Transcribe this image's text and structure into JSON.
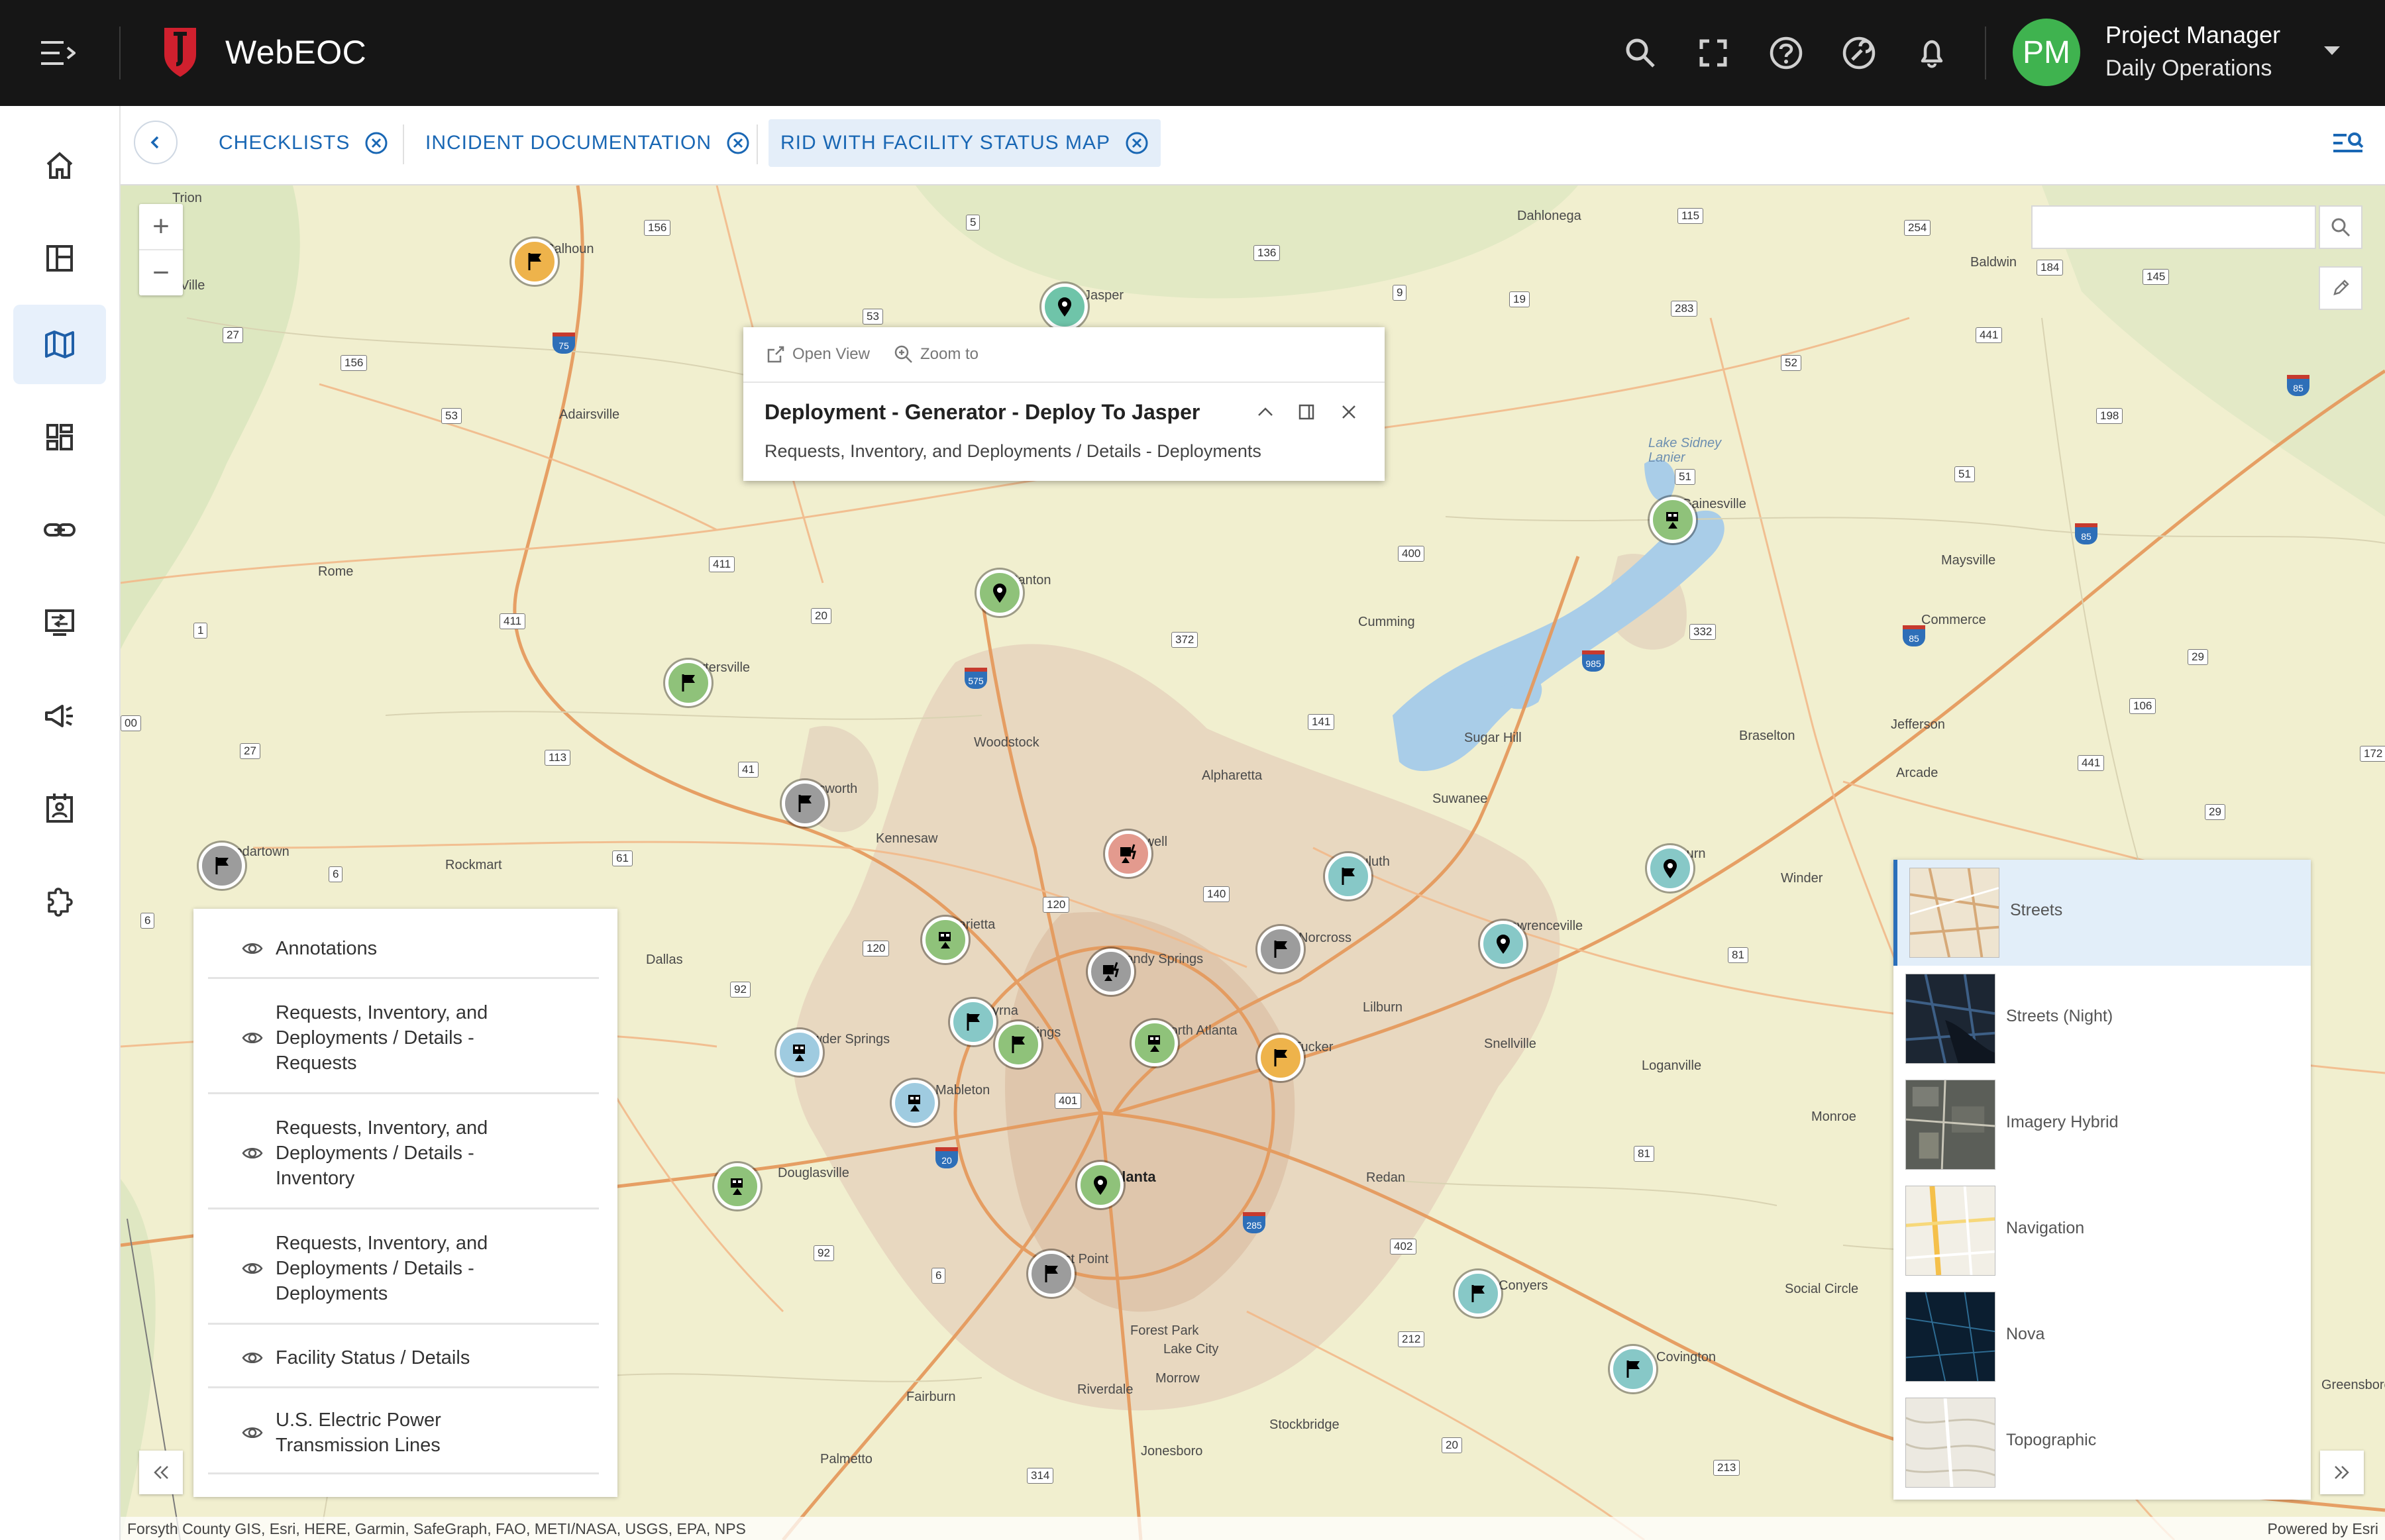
{
  "header": {
    "app_title": "WebEOC",
    "user_initials": "PM",
    "user_name": "Project Manager",
    "user_role": "Daily Operations",
    "colors": {
      "bar": "#161616",
      "logo": "#d0202e",
      "avatar": "#3fb34f"
    }
  },
  "nav": {
    "items": [
      {
        "name": "home",
        "icon": "home-icon"
      },
      {
        "name": "boards",
        "icon": "layout-icon"
      },
      {
        "name": "maps",
        "icon": "map-icon",
        "active": true
      },
      {
        "name": "dashboards",
        "icon": "dashboard-icon"
      },
      {
        "name": "links",
        "icon": "link-icon"
      },
      {
        "name": "processes",
        "icon": "monitor-icon"
      },
      {
        "name": "alerts",
        "icon": "megaphone-icon"
      },
      {
        "name": "contacts",
        "icon": "contact-card-icon"
      },
      {
        "name": "plugins",
        "icon": "puzzle-icon"
      }
    ]
  },
  "tabs": [
    {
      "label": "CHECKLISTS"
    },
    {
      "label": "INCIDENT DOCUMENTATION"
    },
    {
      "label": "RID WITH FACILITY STATUS MAP",
      "active": true
    }
  ],
  "popup": {
    "open_view": "Open View",
    "zoom_to": "Zoom to",
    "title": "Deployment - Generator - Deploy To Jasper",
    "subtitle": "Requests, Inventory, and Deployments / Details - Deployments"
  },
  "search": {
    "placeholder": "",
    "value": ""
  },
  "layers": [
    "Annotations",
    "Requests, Inventory, and Deployments / Details - Requests",
    "Requests, Inventory, and Deployments / Details - Inventory",
    "Requests, Inventory, and Deployments / Details - Deployments",
    "Facility Status / Details",
    "U.S. Electric Power Transmission Lines"
  ],
  "basemaps": [
    {
      "name": "Streets",
      "selected": true
    },
    {
      "name": "Streets (Night)"
    },
    {
      "name": "Imagery Hybrid"
    },
    {
      "name": "Navigation"
    },
    {
      "name": "Nova"
    },
    {
      "name": "Topographic"
    }
  ],
  "map": {
    "attribution": "Forsyth County GIS, Esri, HERE, Garmin, SafeGraph, FAO, METI/NASA, USGS, EPA, NPS",
    "powered_by": "Powered by Esri",
    "towns": [
      {
        "t": "Trion"
      },
      {
        "t": "Calhoun"
      },
      {
        "t": "Dahlonega"
      },
      {
        "t": "Baldwin"
      },
      {
        "t": "Adairsville"
      },
      {
        "t": "Rome"
      },
      {
        "t": "Cartersville"
      },
      {
        "t": "Canton"
      },
      {
        "t": "Cumming"
      },
      {
        "t": "Gainesville"
      },
      {
        "t": "Lake Sidney Lanier"
      },
      {
        "t": "Maysville"
      },
      {
        "t": "Commerce"
      },
      {
        "t": "Woodstock"
      },
      {
        "t": "Alpharetta"
      },
      {
        "t": "Sugar Hill"
      },
      {
        "t": "Braselton"
      },
      {
        "t": "Jefferson"
      },
      {
        "t": "Arcade"
      },
      {
        "t": "Acworth"
      },
      {
        "t": "Kennesaw"
      },
      {
        "t": "Roswell"
      },
      {
        "t": "Suwanee"
      },
      {
        "t": "Duluth"
      },
      {
        "t": "Auburn"
      },
      {
        "t": "Winder"
      },
      {
        "t": "Cedartown"
      },
      {
        "t": "Rockmart"
      },
      {
        "t": "Dallas"
      },
      {
        "t": "Marietta"
      },
      {
        "t": "Sandy Springs"
      },
      {
        "t": "Norcross"
      },
      {
        "t": "Lawrenceville"
      },
      {
        "t": "Smyrna"
      },
      {
        "t": "Vinings"
      },
      {
        "t": "Powder Springs"
      },
      {
        "t": "North Atlanta"
      },
      {
        "t": "Tucker"
      },
      {
        "t": "Lilburn"
      },
      {
        "t": "Snellville"
      },
      {
        "t": "Loganville"
      },
      {
        "t": "Mableton"
      },
      {
        "t": "Monroe"
      },
      {
        "t": "Douglasville"
      },
      {
        "t": "Atlanta"
      },
      {
        "t": "Redan"
      },
      {
        "t": "East Point"
      },
      {
        "t": "Conyers"
      },
      {
        "t": "Social Circle"
      },
      {
        "t": "Covington"
      },
      {
        "t": "Forest Park"
      },
      {
        "t": "Lake City"
      },
      {
        "t": "Morrow"
      },
      {
        "t": "Riverdale"
      },
      {
        "t": "Fairburn"
      },
      {
        "t": "Stockbridge"
      },
      {
        "t": "Jonesboro"
      },
      {
        "t": "Palmetto"
      },
      {
        "t": "Greensboro"
      },
      {
        "t": "Jasper"
      },
      {
        "t": "Ville"
      }
    ],
    "route_shields": [
      "156",
      "5",
      "115",
      "254",
      "136",
      "9",
      "19",
      "283",
      "53",
      "27",
      "156",
      "52",
      "441",
      "184",
      "145",
      "198",
      "53",
      "51",
      "51",
      "411",
      "411",
      "20",
      "1",
      "372",
      "400",
      "332",
      "141",
      "106",
      "29",
      "41",
      "27",
      "113",
      "61",
      "6",
      "6",
      "120",
      "140",
      "172",
      "29",
      "92",
      "120",
      "401",
      "81",
      "81",
      "92",
      "6",
      "402",
      "212",
      "20",
      "213",
      "314",
      "441",
      "00"
    ],
    "interstates": [
      "75",
      "85",
      "985",
      "85",
      "575",
      "20",
      "285",
      "85"
    ],
    "markers": [
      {
        "color": "orange",
        "icon": "flag-icon"
      },
      {
        "color": "mint",
        "icon": "pin-icon"
      },
      {
        "color": "green",
        "icon": "facility-icon"
      },
      {
        "color": "green",
        "icon": "pin-icon"
      },
      {
        "color": "green",
        "icon": "flag-icon"
      },
      {
        "color": "gray",
        "icon": "flag-icon"
      },
      {
        "color": "gray",
        "icon": "flag-icon"
      },
      {
        "color": "red",
        "icon": "generator-icon"
      },
      {
        "color": "teal",
        "icon": "flag-icon"
      },
      {
        "color": "teal",
        "icon": "pin-icon"
      },
      {
        "color": "teal",
        "icon": "pin-icon"
      },
      {
        "color": "green",
        "icon": "facility-icon"
      },
      {
        "color": "gray",
        "icon": "generator-icon"
      },
      {
        "color": "gray",
        "icon": "flag-icon"
      },
      {
        "color": "teal",
        "icon": "flag-icon"
      },
      {
        "color": "green",
        "icon": "flag-icon"
      },
      {
        "color": "green",
        "icon": "facility-icon"
      },
      {
        "color": "orange",
        "icon": "flag-icon"
      },
      {
        "color": "blue",
        "icon": "facility-icon"
      },
      {
        "color": "blue",
        "icon": "facility-icon"
      },
      {
        "color": "green",
        "icon": "facility-icon"
      },
      {
        "color": "green",
        "icon": "pin-icon"
      },
      {
        "color": "gray",
        "icon": "flag-icon"
      },
      {
        "color": "teal",
        "icon": "flag-icon"
      },
      {
        "color": "teal",
        "icon": "flag-icon"
      }
    ]
  }
}
